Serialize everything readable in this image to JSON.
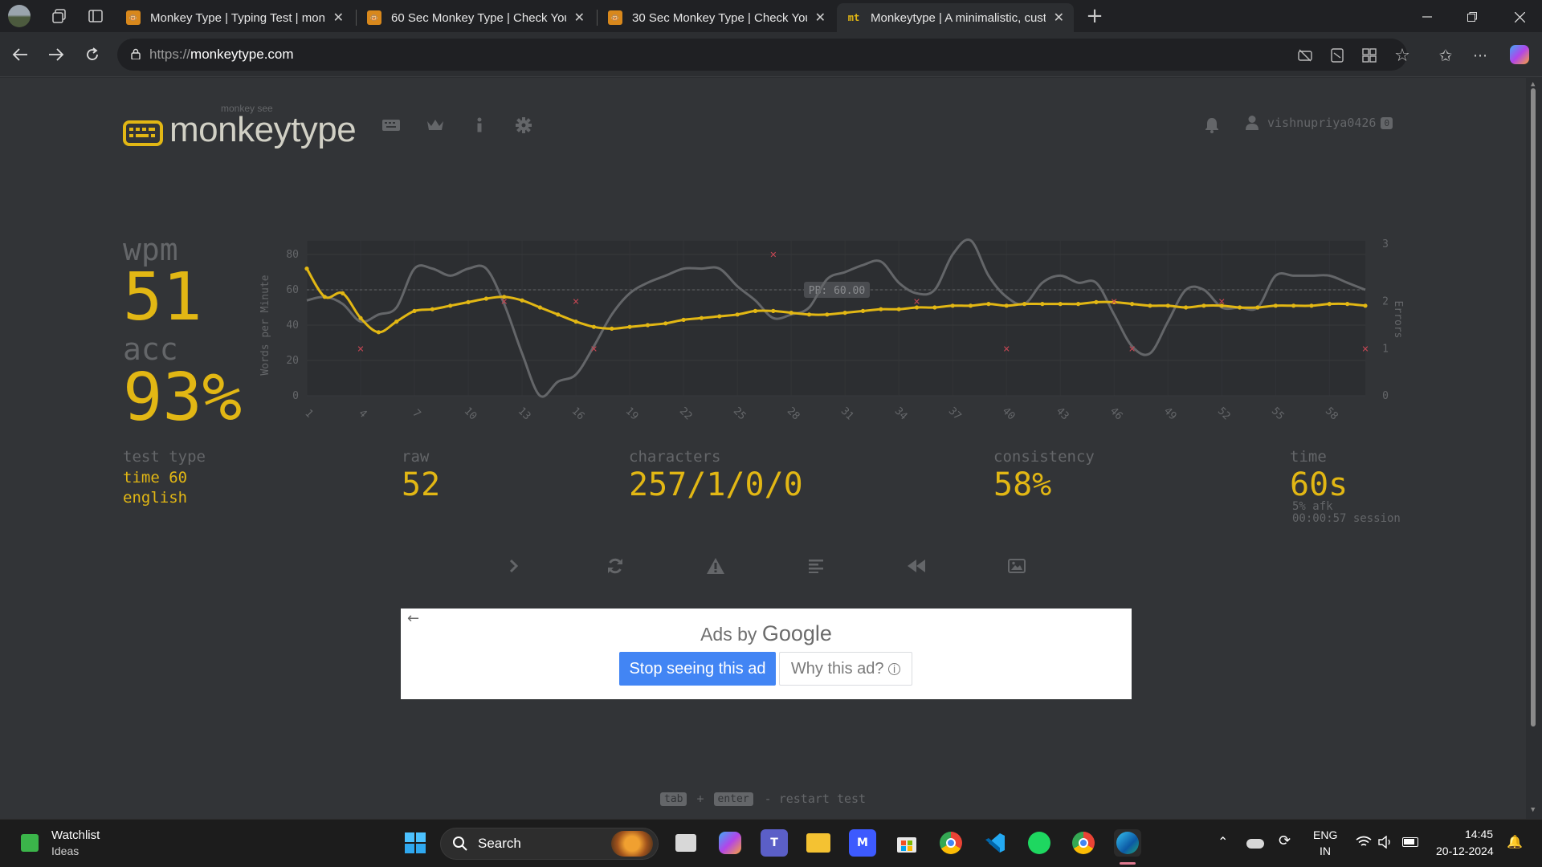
{
  "browser": {
    "tabs": [
      {
        "title": "Monkey Type | Typing Test | monk",
        "active": false
      },
      {
        "title": "60 Sec Monkey Type | Check Your",
        "active": false
      },
      {
        "title": "30 Sec Monkey Type | Check Your",
        "active": false
      },
      {
        "title": "Monkeytype | A minimalistic, cust",
        "active": true
      }
    ],
    "new_tab": "+",
    "url_protocol": "https://",
    "url_host": "monkeytype.com"
  },
  "app": {
    "logo_small": "monkey see",
    "logo_text": "monkeytype",
    "username": "vishnupriya0426",
    "level": "0",
    "colors": {
      "accent": "#e2b714",
      "sub": "#646669",
      "bg": "#323437",
      "text": "#d1d0c5",
      "error": "#ca4754"
    }
  },
  "result": {
    "wpm_label": "wpm",
    "wpm": "51",
    "acc_label": "acc",
    "acc": "93%",
    "test_type_label": "test type",
    "test_type_line1": "time 60",
    "test_type_line2": "english",
    "raw_label": "raw",
    "raw": "52",
    "characters_label": "characters",
    "characters": "257/1/0/0",
    "consistency_label": "consistency",
    "consistency": "58%",
    "time_label": "time",
    "time": "60s",
    "afk": "5% afk",
    "session": "00:00:57 session"
  },
  "chart_data": {
    "type": "line",
    "ylabel": "Words per Minute",
    "y2label": "Errors",
    "ylim": [
      0,
      80
    ],
    "y2lim": [
      0,
      3
    ],
    "yticks": [
      0,
      20,
      40,
      60,
      80
    ],
    "y2ticks": [
      0,
      1,
      2,
      3
    ],
    "xlim": [
      1,
      60
    ],
    "xticks": [
      1,
      4,
      7,
      10,
      13,
      16,
      19,
      22,
      25,
      28,
      31,
      34,
      37,
      40,
      43,
      46,
      49,
      52,
      55,
      58
    ],
    "pb_label": "PB: 60.00",
    "pb_value": 60,
    "series": [
      {
        "name": "raw",
        "color": "#646669",
        "values": [
          54,
          56,
          52,
          42,
          46,
          50,
          72,
          72,
          68,
          72,
          72,
          52,
          24,
          0,
          8,
          12,
          28,
          46,
          58,
          64,
          68,
          72,
          72,
          72,
          62,
          54,
          44,
          46,
          50,
          66,
          70,
          74,
          76,
          64,
          58,
          60,
          80,
          88,
          68,
          56,
          52,
          64,
          68,
          64,
          64,
          46,
          28,
          24,
          42,
          60,
          60,
          50,
          50,
          50,
          68,
          68,
          68,
          68,
          64,
          60
        ]
      },
      {
        "name": "wpm",
        "color": "#e2b714",
        "values": [
          72,
          56,
          58,
          44,
          36,
          42,
          48,
          49,
          51,
          53,
          55,
          56,
          54,
          50,
          46,
          42,
          39,
          38,
          39,
          40,
          41,
          43,
          44,
          45,
          46,
          48,
          48,
          47,
          46,
          46,
          47,
          48,
          49,
          49,
          50,
          50,
          51,
          51,
          52,
          51,
          52,
          52,
          52,
          52,
          53,
          53,
          52,
          51,
          51,
          50,
          51,
          51,
          50,
          50,
          51,
          51,
          51,
          52,
          52,
          51
        ]
      },
      {
        "name": "errors",
        "color": "#ca4754",
        "points": [
          [
            4,
            1
          ],
          [
            12,
            2
          ],
          [
            16,
            2
          ],
          [
            17,
            1
          ],
          [
            27,
            3
          ],
          [
            35,
            2
          ],
          [
            40,
            1
          ],
          [
            46,
            2
          ],
          [
            47,
            1
          ],
          [
            52,
            2
          ],
          [
            60,
            1
          ]
        ]
      }
    ]
  },
  "actions": [
    {
      "name": "next-test-button",
      "icon": "chevron-right"
    },
    {
      "name": "repeat-test-button",
      "icon": "sync"
    },
    {
      "name": "practice-words-button",
      "icon": "warning"
    },
    {
      "name": "words-history-button",
      "icon": "align-left"
    },
    {
      "name": "replay-button",
      "icon": "backward"
    },
    {
      "name": "screenshot-button",
      "icon": "image"
    }
  ],
  "ad": {
    "ads_by": "Ads by",
    "google": "Google",
    "stop": "Stop seeing this ad",
    "why": "Why this ad?"
  },
  "hint": {
    "key1": "tab",
    "plus": "+",
    "key2": "enter",
    "text": "- restart test"
  },
  "taskbar": {
    "widget_title": "Watchlist",
    "widget_sub": "Ideas",
    "search": "Search",
    "lang1": "ENG",
    "lang2": "IN",
    "time": "14:45",
    "date": "20-12-2024"
  }
}
